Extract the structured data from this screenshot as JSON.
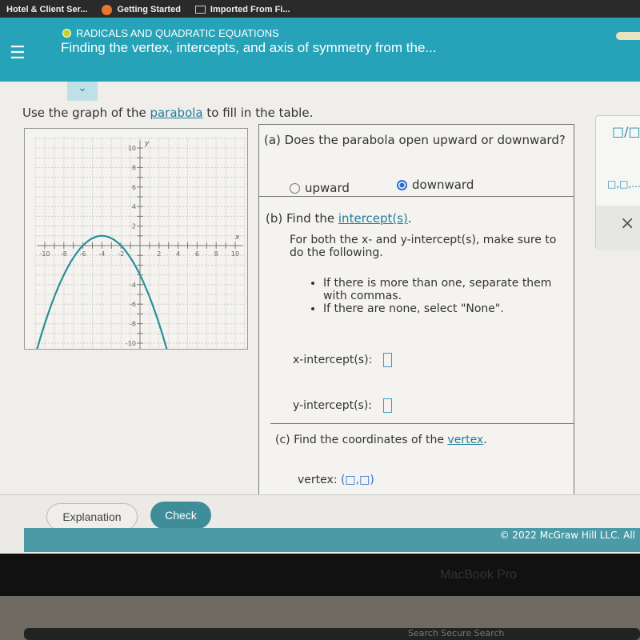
{
  "bookmarks": [
    "Hotel & Client Ser...",
    "Getting Started",
    "Imported From Fi..."
  ],
  "header": {
    "topic": "RADICALS AND QUADRATIC EQUATIONS",
    "title": "Finding the vertex, intercepts, and axis of symmetry from the...",
    "topic_dot_color": "#c8d41e",
    "bg_color": "#26a3b8"
  },
  "instruction": {
    "before": "Use the graph of the ",
    "link": "parabola",
    "after": " to fill in the table."
  },
  "chart_data": {
    "type": "line",
    "xlabel": "x",
    "ylabel": "y",
    "xlim": [
      -10,
      10
    ],
    "ylim": [
      -10,
      10
    ],
    "grid": true,
    "xticks": [
      -10,
      -8,
      -6,
      -4,
      -2,
      2,
      4,
      6,
      8,
      10
    ],
    "yticks": [
      10,
      8,
      6,
      4,
      2,
      -4,
      -6,
      -8,
      -10
    ],
    "series": [
      {
        "function": "y = -(x+4)^2/4 + 1",
        "vertex": [
          -4,
          1
        ],
        "x_intercepts": [
          -6,
          -2
        ],
        "y_intercept": -3,
        "color": "#2a8f96"
      }
    ]
  },
  "part_a": {
    "question": "(a) Does the parabola open upward or downward?",
    "options": [
      {
        "label": "upward",
        "selected": false
      },
      {
        "label": "downward",
        "selected": true
      }
    ]
  },
  "part_b": {
    "prefix": "(b) Find the ",
    "link": "intercept(s)",
    "suffix": ".",
    "note": "For both the x- and y-intercept(s), make sure to do the following.",
    "bullets": [
      "If there is more than one, separate them with commas.",
      "If there are none, select \"None\"."
    ],
    "x_label": "x-intercept(s):",
    "y_label": "y-intercept(s):",
    "x_value": "",
    "y_value": ""
  },
  "part_c": {
    "prefix": "(c) Find the coordinates of the ",
    "link": "vertex",
    "suffix": ".",
    "label": "vertex:"
  },
  "tools": {
    "fraction": "□/□",
    "list": "□,□,...",
    "clear": "×"
  },
  "footer": {
    "explanation": "Explanation",
    "check": "Check",
    "copyright": "© 2022 McGraw Hill LLC. All"
  },
  "device": {
    "label": "MacBook Pro",
    "search": "Search Secure Search"
  }
}
